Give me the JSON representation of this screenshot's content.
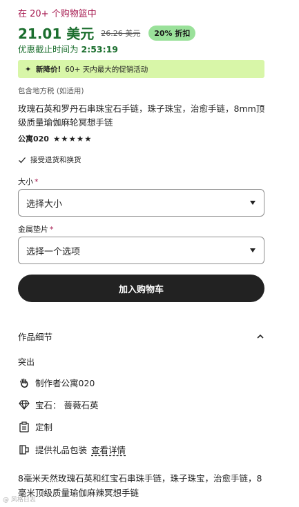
{
  "basket_text": "在 20+ 个购物篮中",
  "price": {
    "current": "21.01 美元",
    "original": "26.26 美元",
    "discount": "20% 折扣",
    "sale_prefix": "优惠截止时间为",
    "sale_time": "2:53:19"
  },
  "promo": {
    "icon": "sparkle-icon",
    "bold": "新降价!",
    "text": "60+ 天内最大的促销活动"
  },
  "tax_note": "包含地方税 (如适用)",
  "product_title": "玫瑰石英和罗丹石串珠宝石手链，珠子珠宝，治愈手链，8mm顶级质量瑜伽麻轮冥想手链",
  "shop": {
    "name": "公寓020",
    "rating_stars": "★★★★★"
  },
  "returns_text": "接受退货和换货",
  "size": {
    "label": "大小",
    "required_mark": "*",
    "selected": "选择大小"
  },
  "metal": {
    "label": "金属垫片",
    "required_mark": "*",
    "selected": "选择一个选项"
  },
  "cart_button": "加入购物车",
  "details": {
    "heading": "作品细节",
    "highlights_label": "突出",
    "maker": "制作者公寓020",
    "gemstone": "宝石： 蔷薇石英",
    "custom": "定制",
    "gift": "提供礼品包装",
    "gift_link": "查看详情"
  },
  "description": "8毫米天然玫瑰石英和红宝石串珠手链，珠子珠宝，治愈手链，8毫米顶级质量瑜伽麻辣冥想手链",
  "watermark": "@ 风格日志",
  "colors": {
    "sale_green": "#1b6e2e",
    "basket_red": "#a61a50",
    "promo_bg": "#d8f6a8",
    "discount_bg": "#9ae19a",
    "button_dark": "#222222"
  }
}
